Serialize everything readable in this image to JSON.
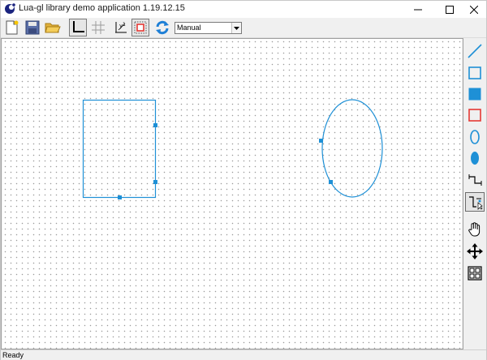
{
  "window": {
    "title": "Lua-gl library demo application 1.19.12.15"
  },
  "toolbar": {
    "buttons": [
      {
        "name": "new-document-icon"
      },
      {
        "name": "save-icon"
      },
      {
        "name": "open-folder-icon"
      },
      {
        "name": "axes-icon"
      },
      {
        "name": "grid-icon"
      },
      {
        "name": "snap-to-grid-icon"
      },
      {
        "name": "select-rectangle-icon"
      },
      {
        "name": "refresh-icon"
      }
    ],
    "mode_select": {
      "value": "Manual"
    }
  },
  "right_toolbar": {
    "tools": [
      {
        "name": "line-tool-icon"
      },
      {
        "name": "rectangle-tool-icon"
      },
      {
        "name": "filled-rectangle-tool-icon"
      },
      {
        "name": "blocking-rectangle-tool-icon"
      },
      {
        "name": "ellipse-tool-icon"
      },
      {
        "name": "filled-ellipse-tool-icon"
      },
      {
        "name": "connector-tool-icon"
      },
      {
        "name": "connector-drag-tool-icon"
      },
      {
        "name": "pan-hand-icon"
      },
      {
        "name": "move-icon"
      },
      {
        "name": "group-icon"
      }
    ]
  },
  "colors": {
    "shape_stroke": "#1e90d6",
    "tool_blue": "#1e90d6",
    "tool_red": "#e53935"
  },
  "status": {
    "text": "Ready"
  }
}
